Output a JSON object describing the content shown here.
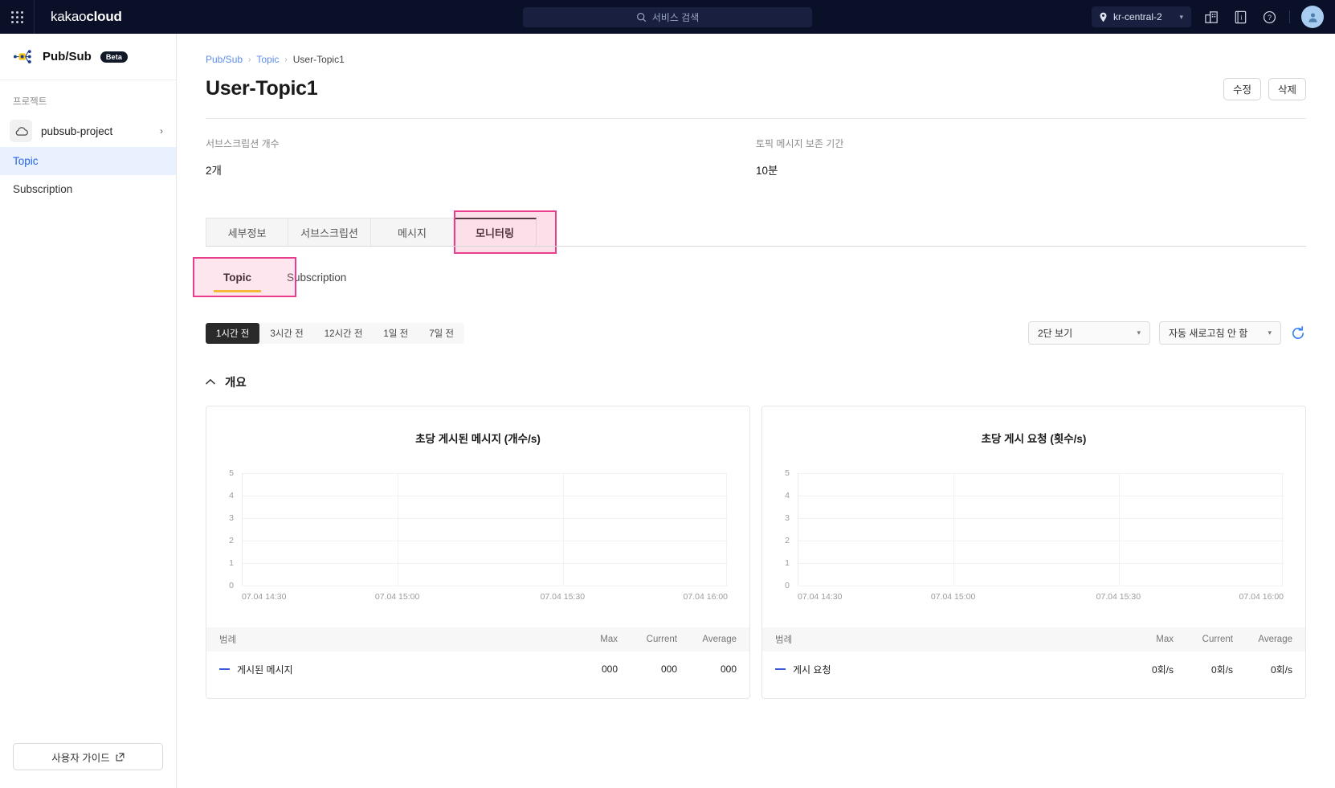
{
  "topbar": {
    "apps_icon": "grid-apps-icon",
    "brand_light": "kakao",
    "brand_bold": "cloud",
    "search_placeholder": "서비스 검색",
    "search_icon": "search-icon",
    "region": "kr-central-2",
    "region_icon": "location-pin-icon",
    "region_chevron": "chevron-down-icon",
    "icons": [
      "organization-building-icon",
      "documentation-book-icon",
      "help-question-icon"
    ],
    "avatar": "user-avatar-icon"
  },
  "sidebar": {
    "service_name": "Pub/Sub",
    "service_badge": "Beta",
    "service_icon": "pubsub-topology-icon",
    "project_label": "프로젝트",
    "project_name": "pubsub-project",
    "project_icon": "cloud-icon",
    "project_chevron": "chevron-right-icon",
    "nav": [
      {
        "label": "Topic",
        "active": true
      },
      {
        "label": "Subscription",
        "active": false
      }
    ],
    "guide_label": "사용자 가이드",
    "guide_icon": "external-link-icon"
  },
  "breadcrumb": {
    "items": [
      "Pub/Sub",
      "Topic",
      "User-Topic1"
    ],
    "separator": "›"
  },
  "page": {
    "title": "User-Topic1",
    "edit_label": "수정",
    "delete_label": "삭제"
  },
  "summary": [
    {
      "label": "서브스크립션 개수",
      "value": "2개"
    },
    {
      "label": "토픽 메시지 보존 기간",
      "value": "10분"
    }
  ],
  "tabs": [
    {
      "label": "세부정보",
      "active": false
    },
    {
      "label": "서브스크립션",
      "active": false
    },
    {
      "label": "메시지",
      "active": false
    },
    {
      "label": "모니터링",
      "active": true,
      "highlighted": true
    }
  ],
  "subtabs": [
    {
      "label": "Topic",
      "active": true,
      "highlighted": true
    },
    {
      "label": "Subscription",
      "active": false
    }
  ],
  "controls": {
    "ranges": [
      {
        "label": "1시간 전",
        "active": true
      },
      {
        "label": "3시간 전",
        "active": false
      },
      {
        "label": "12시간 전",
        "active": false
      },
      {
        "label": "1일 전",
        "active": false
      },
      {
        "label": "7일 전",
        "active": false
      }
    ],
    "layout_select": "2단 보기",
    "refresh_select": "자동 새로고침 안 함",
    "refresh_icon": "refresh-circular-arrow-icon",
    "chevron": "chevron-down-icon"
  },
  "section": {
    "title": "개요",
    "collapse_icon": "chevron-up-icon"
  },
  "legend_headers": {
    "name": "범례",
    "max": "Max",
    "current": "Current",
    "average": "Average"
  },
  "chart_data": [
    {
      "type": "line",
      "title": "초당 게시된 메시지 (개수/s)",
      "xlabel": "",
      "ylabel": "",
      "ylim": [
        0,
        5
      ],
      "yticks": [
        "5",
        "4",
        "3",
        "2",
        "1",
        "0"
      ],
      "xticks": [
        "07.04 14:30",
        "07.04 15:00",
        "07.04 15:30",
        "07.04 16:00"
      ],
      "grid": true,
      "legend_position": "bottom-table",
      "series": [
        {
          "name": "게시된 메시지",
          "color": "#3b5bdb",
          "values": [],
          "max": "000",
          "current": "000",
          "average": "000"
        }
      ]
    },
    {
      "type": "line",
      "title": "초당 게시 요청 (횟수/s)",
      "xlabel": "",
      "ylabel": "",
      "ylim": [
        0,
        5
      ],
      "yticks": [
        "5",
        "4",
        "3",
        "2",
        "1",
        "0"
      ],
      "xticks": [
        "07.04 14:30",
        "07.04 15:00",
        "07.04 15:30",
        "07.04 16:00"
      ],
      "grid": true,
      "legend_position": "bottom-table",
      "series": [
        {
          "name": "게시 요청",
          "color": "#3b5bdb",
          "values": [],
          "max": "0회/s",
          "current": "0회/s",
          "average": "0회/s"
        }
      ]
    }
  ]
}
